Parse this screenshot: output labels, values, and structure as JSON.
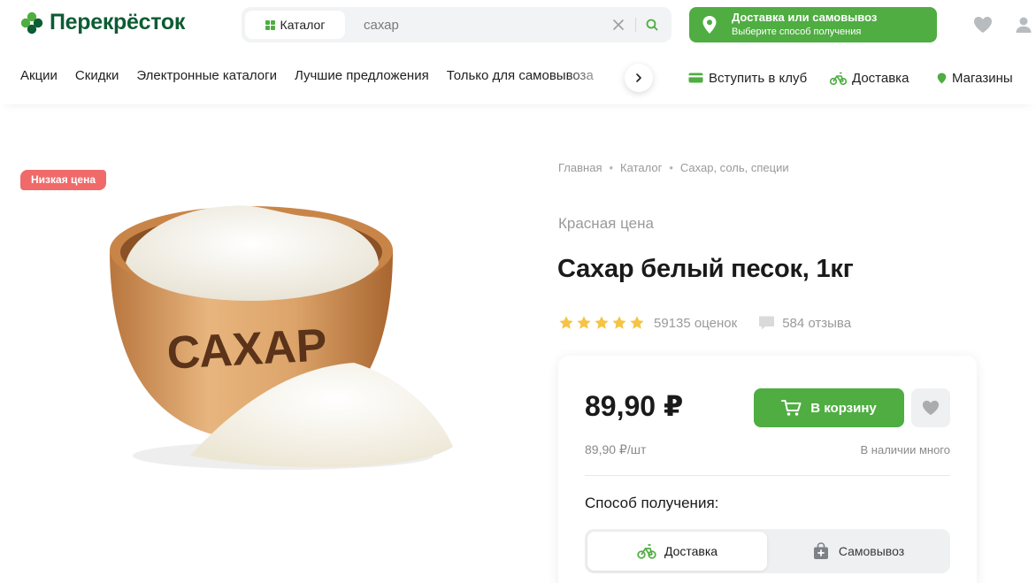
{
  "brand": {
    "name": "Перекрёсток",
    "color": "#0d5c33",
    "accent": "#4fad42"
  },
  "search": {
    "catalog_label": "Каталог",
    "value": "сахар",
    "clear_icon": "close-icon",
    "submit_icon": "search-icon"
  },
  "delivery": {
    "title": "Доставка или самовывоз",
    "subtitle": "Выберите способ получения",
    "icon": "map-pin-icon"
  },
  "header_icons": [
    "heart-icon",
    "user-icon"
  ],
  "nav": {
    "items": [
      "Акции",
      "Скидки",
      "Электронные каталоги",
      "Лучшие предложения",
      "Только для самовывоза"
    ],
    "right": {
      "club": "Вступить в клуб",
      "delivery": "Доставка",
      "stores": "Магазины"
    }
  },
  "product": {
    "badge": "Низкая цена",
    "badge_color": "#f06a6a",
    "image_label": "САХАР",
    "breadcrumb": [
      "Главная",
      "Каталог",
      "Сахар, соль, специи"
    ],
    "brand": "Красная цена",
    "title": "Сахар белый песок, 1кг",
    "rating": {
      "stars": 5,
      "max": 5,
      "count_text": "59135 оценок",
      "reviews_text": "584 отзыва",
      "star_color": "#f6c343"
    },
    "price": "89,90 ₽",
    "unit_price": "89,90 ₽/шт",
    "stock": "В наличии много",
    "cart_button": "В корзину",
    "method_label": "Способ получения:",
    "methods": [
      {
        "label": "Доставка",
        "icon": "bicycle-icon",
        "selected": true
      },
      {
        "label": "Самовывоз",
        "icon": "shopping-bag-icon",
        "selected": false
      }
    ]
  }
}
